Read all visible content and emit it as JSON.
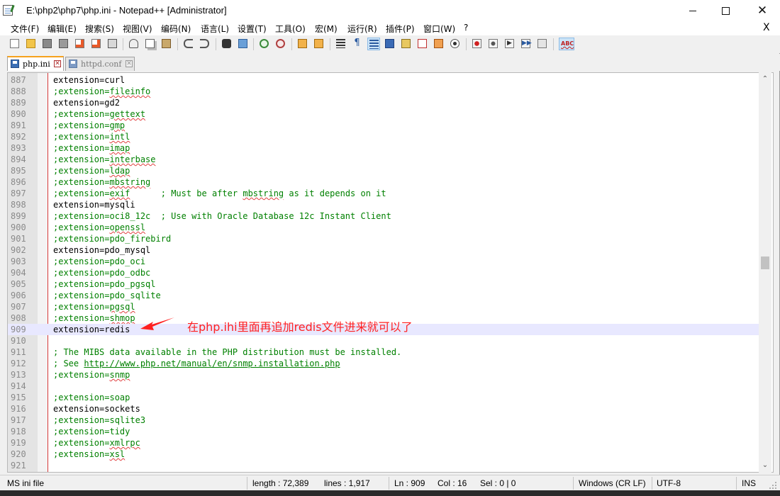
{
  "window": {
    "title": "E:\\php2\\php7\\php.ini - Notepad++ [Administrator]",
    "min_label": "",
    "close_label": "✕"
  },
  "menu": {
    "items": [
      "文件(F)",
      "编辑(E)",
      "搜索(S)",
      "视图(V)",
      "编码(N)",
      "语言(L)",
      "设置(T)",
      "工具(O)",
      "宏(M)",
      "运行(R)",
      "插件(P)",
      "窗口(W)",
      "?"
    ],
    "close_label": "X"
  },
  "toolbar": {
    "abc_label": "ABC"
  },
  "tabs": [
    {
      "label": "php.ini",
      "active": true
    },
    {
      "label": "httpd.conf",
      "active": false
    }
  ],
  "editor": {
    "lines": [
      {
        "n": "887",
        "text": "extension=curl",
        "comment": false,
        "current": false
      },
      {
        "n": "888",
        "pre": ";extension=",
        "sq": "fileinfo",
        "comment": true
      },
      {
        "n": "889",
        "text": "extension=gd2",
        "comment": false
      },
      {
        "n": "890",
        "pre": ";extension=",
        "sq": "gettext",
        "comment": true
      },
      {
        "n": "891",
        "pre": ";extension=",
        "sq": "gmp",
        "comment": true
      },
      {
        "n": "892",
        "pre": ";extension=",
        "sq": "intl",
        "comment": true
      },
      {
        "n": "893",
        "pre": ";extension=",
        "sq": "imap",
        "comment": true
      },
      {
        "n": "894",
        "pre": ";extension=",
        "sq": "interbase",
        "comment": true
      },
      {
        "n": "895",
        "pre": ";extension=",
        "sq": "ldap",
        "comment": true
      },
      {
        "n": "896",
        "pre": ";extension=",
        "sq": "mbstring",
        "comment": true
      },
      {
        "n": "897",
        "pre": ";extension=",
        "sq": "exif",
        "post": "      ; Must be after ",
        "sq2": "mbstring",
        "post2": " as it depends on it",
        "comment": true
      },
      {
        "n": "898",
        "text": "extension=mysqli",
        "comment": false
      },
      {
        "n": "899",
        "text": ";extension=oci8_12c  ; Use with Oracle Database 12c Instant Client",
        "comment": true
      },
      {
        "n": "900",
        "pre": ";extension=",
        "sq": "openssl",
        "comment": true
      },
      {
        "n": "901",
        "text": ";extension=pdo_firebird",
        "comment": true
      },
      {
        "n": "902",
        "text": "extension=pdo_mysql",
        "comment": false
      },
      {
        "n": "903",
        "text": ";extension=pdo_oci",
        "comment": true
      },
      {
        "n": "904",
        "text": ";extension=pdo_odbc",
        "comment": true
      },
      {
        "n": "905",
        "text": ";extension=pdo_pgsql",
        "comment": true
      },
      {
        "n": "906",
        "text": ";extension=pdo_sqlite",
        "comment": true
      },
      {
        "n": "907",
        "pre": ";extension=",
        "sq": "pgsql",
        "comment": true
      },
      {
        "n": "908",
        "pre": ";extension=",
        "sq": "shmop",
        "comment": true
      },
      {
        "n": "909",
        "text": "extension=redis",
        "comment": false,
        "current": true
      },
      {
        "n": "910",
        "text": "",
        "comment": false
      },
      {
        "n": "911",
        "text": "; The MIBS data available in the PHP distribution must be installed.",
        "comment": true
      },
      {
        "n": "912",
        "pre": "; See ",
        "url": "http://www.php.net/manual/en/snmp.installation.php",
        "comment": true
      },
      {
        "n": "913",
        "pre": ";extension=",
        "sq": "snmp",
        "comment": true
      },
      {
        "n": "914",
        "text": "",
        "comment": false
      },
      {
        "n": "915",
        "text": ";extension=soap",
        "comment": true
      },
      {
        "n": "916",
        "text": "extension=sockets",
        "comment": false
      },
      {
        "n": "917",
        "text": ";extension=sqlite3",
        "comment": true
      },
      {
        "n": "918",
        "text": ";extension=tidy",
        "comment": true
      },
      {
        "n": "919",
        "pre": ";extension=",
        "sq": "xmlrpc",
        "comment": true
      },
      {
        "n": "920",
        "pre": ";extension=",
        "sq": "xsl",
        "comment": true
      },
      {
        "n": "921",
        "text": "",
        "comment": false
      }
    ]
  },
  "annotation": {
    "text": "在php.ihi里面再追加redis文件进来就可以了",
    "color": "#ff2020"
  },
  "status": {
    "file_type": "MS ini file",
    "length": "length : 72,389",
    "lines": "lines : 1,917",
    "ln": "Ln : 909",
    "col": "Col : 16",
    "sel": "Sel : 0 | 0",
    "eol": "Windows (CR LF)",
    "encoding": "UTF-8",
    "mode": "INS"
  }
}
